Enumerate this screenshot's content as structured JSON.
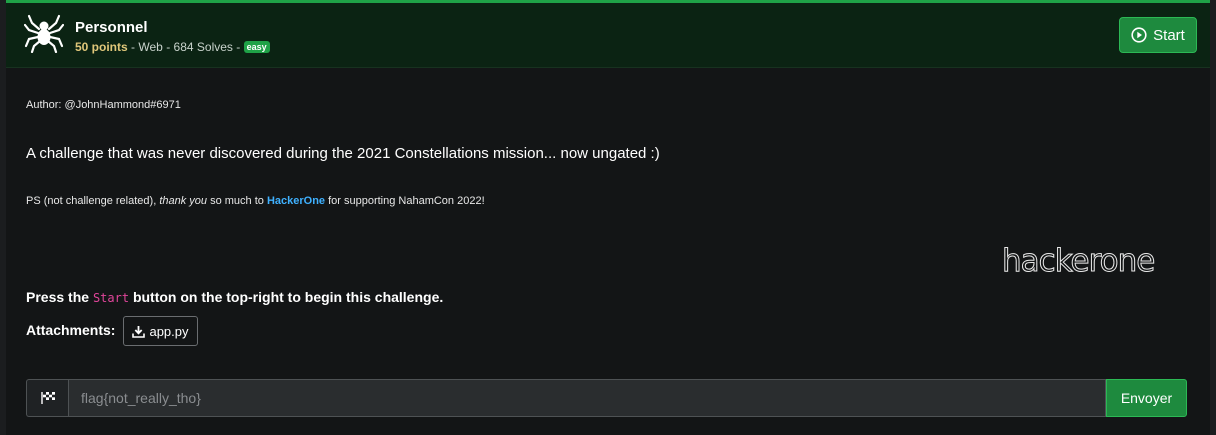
{
  "challenge": {
    "title": "Personnel",
    "points": "50 points",
    "category": "Web",
    "solves": "684 Solves",
    "difficulty": "easy",
    "start_label": "Start"
  },
  "description": {
    "author": "Author: @JohnHammond#6971",
    "text": "A challenge that was never discovered during the 2021 Constellations mission... now ungated :)",
    "ps_prefix": "PS (not challenge related), ",
    "ps_emphasis": "thank you",
    "ps_middle": " so much to ",
    "ps_link": "HackerOne",
    "ps_suffix": " for supporting NahamCon 2022!",
    "sponsor_logo_text": "hackerone",
    "press_prefix": "Press the ",
    "press_code": "Start",
    "press_suffix": " button on the top-right to begin this challenge.",
    "attachments_label": "Attachments:",
    "attachment_file": "app.py"
  },
  "flag_form": {
    "placeholder": "flag{not_really_tho}",
    "submit_label": "Envoyer"
  },
  "colors": {
    "accent": "#1fa247",
    "link": "#3fb1ff",
    "code": "#e0459a"
  },
  "icons": [
    "spider-icon",
    "play-circle-icon",
    "download-icon",
    "checkered-flag-icon"
  ]
}
